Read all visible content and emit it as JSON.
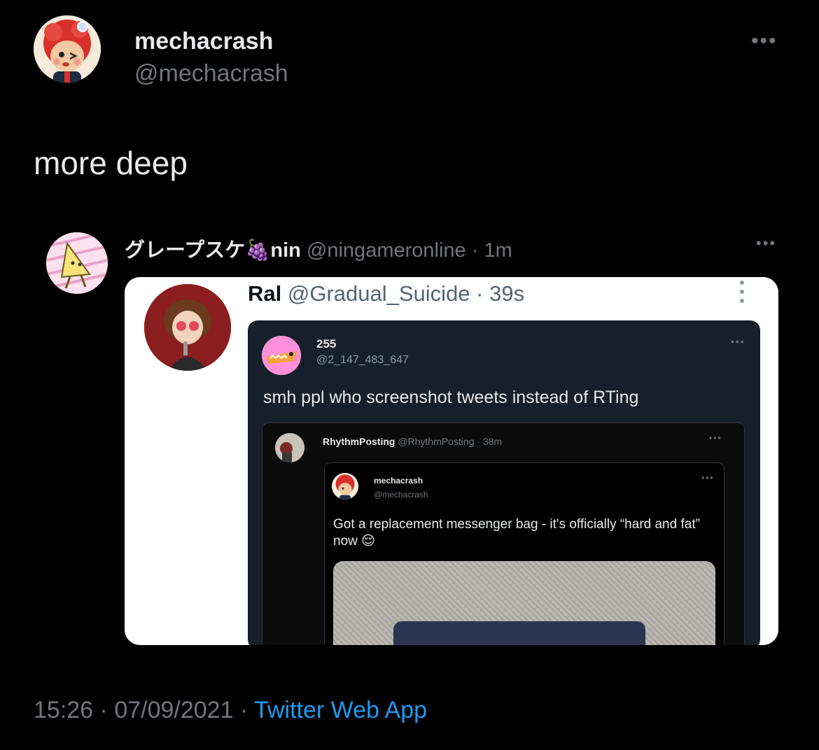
{
  "tweet": {
    "author_name": "mechacrash",
    "author_handle": "@mechacrash",
    "more_label": "•••",
    "text": "more deep",
    "time": "15:26",
    "date": "07/09/2021",
    "separator": " · ",
    "source": "Twitter Web App"
  },
  "quoted": {
    "author_name": "グレープスケ🍇nin",
    "author_handle": "@ningameronline",
    "age": "· 1m",
    "more_label": "•••"
  },
  "screenshot": {
    "ral": {
      "name": "Ral",
      "handle": "@Gradual_Suicide",
      "age": "· 39s",
      "more_label": "⋮"
    },
    "u255": {
      "name": "255",
      "handle": "@2_147_483_647",
      "text": "smh ppl who screenshot tweets instead of RTing",
      "more_label": "•••"
    },
    "rhythm": {
      "name": "RhythmPosting",
      "handle": "@RhythmPosting",
      "age": "· 38m",
      "more_label": "•••"
    },
    "mecha": {
      "name": "mechacrash",
      "handle": "@mechacrash",
      "text": "Got a replacement messenger bag - it's officially “hard and fat” now 😌",
      "more_label": "•••"
    }
  }
}
